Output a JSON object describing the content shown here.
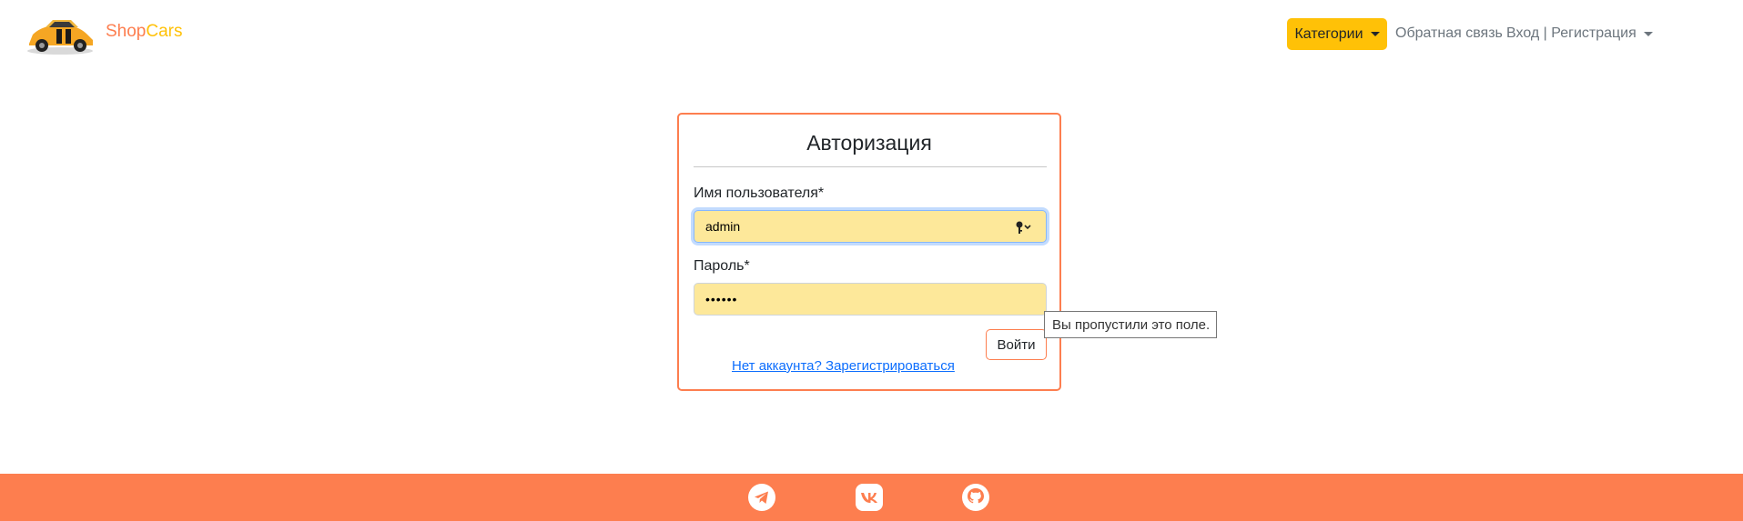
{
  "brand": {
    "name_part1": "Shop",
    "name_part2": "Cars",
    "logo_icon": "car-logo"
  },
  "nav": {
    "categories_label": "Категории",
    "feedback_label": "Обратная связь",
    "login_label": "Вход | Регистрация"
  },
  "form": {
    "title": "Авторизация",
    "username_label": "Имя пользователя*",
    "username_value": "admin",
    "password_label": "Пароль*",
    "password_value": "••••••",
    "submit_label": "Войти",
    "register_link": "Нет аккаунта? Зарегистрироваться"
  },
  "tooltip": {
    "text": "Вы пропустили это поле."
  },
  "footer": {
    "icons": [
      "telegram-icon",
      "vk-icon",
      "github-icon"
    ]
  },
  "colors": {
    "accent": "#fd7e4f",
    "warning": "#ffc107",
    "autofill": "#fde89a",
    "link": "#0d6efd"
  }
}
